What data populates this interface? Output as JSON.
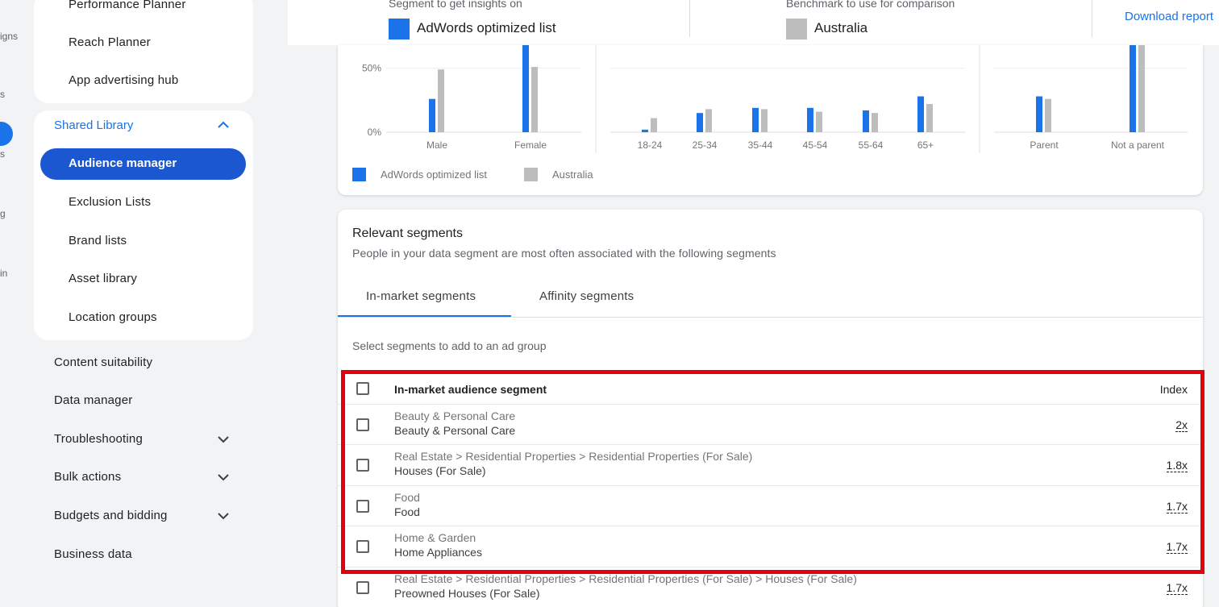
{
  "rail": {
    "labels": [
      "igns",
      "s",
      "s",
      "g",
      "in"
    ]
  },
  "sidebar": {
    "top_items": [
      "Performance Planner",
      "Reach Planner",
      "App advertising hub"
    ],
    "library_header": "Shared Library",
    "active_item": "Audience manager",
    "library_items": [
      "Exclusion Lists",
      "Brand lists",
      "Asset library",
      "Location groups"
    ],
    "section_items": [
      "Content suitability",
      "Data manager",
      "Troubleshooting",
      "Bulk actions",
      "Budgets and bidding",
      "Business data"
    ]
  },
  "topbar": {
    "segment_label": "Segment to get insights on",
    "segment_value": "AdWords optimized list",
    "benchmark_label": "Benchmark to use for comparison",
    "benchmark_value": "Australia",
    "download_label": "Download report",
    "colors": {
      "segment": "#1a73e8",
      "benchmark": "#bdbdbd"
    }
  },
  "chart_data": [
    {
      "type": "bar",
      "categories": [
        "Male",
        "Female"
      ],
      "series": [
        {
          "name": "AdWords optimized list",
          "values": [
            26,
            74
          ]
        },
        {
          "name": "Australia",
          "values": [
            49,
            51
          ]
        }
      ],
      "yticks": [
        "50%",
        "0%"
      ],
      "ylim": [
        0,
        68
      ]
    },
    {
      "type": "bar",
      "categories": [
        "18-24",
        "25-34",
        "35-44",
        "45-54",
        "55-64",
        "65+"
      ],
      "series": [
        {
          "name": "AdWords optimized list",
          "values": [
            2,
            15,
            19,
            19,
            17,
            28
          ]
        },
        {
          "name": "Australia",
          "values": [
            11,
            18,
            18,
            16,
            15,
            22
          ]
        }
      ],
      "ylim": [
        0,
        68
      ]
    },
    {
      "type": "bar",
      "categories": [
        "Parent",
        "Not a parent"
      ],
      "series": [
        {
          "name": "AdWords optimized list",
          "values": [
            28,
            72
          ]
        },
        {
          "name": "Australia",
          "values": [
            26,
            74
          ]
        }
      ],
      "ylim": [
        0,
        68
      ]
    }
  ],
  "legend": {
    "series_a": "AdWords optimized list",
    "series_b": "Australia"
  },
  "segments": {
    "title": "Relevant segments",
    "subtitle": "People in your data segment are most often associated with the following segments",
    "tabs": [
      "In-market segments",
      "Affinity segments"
    ],
    "hint": "Select segments to add to an ad group",
    "header": {
      "segment": "In-market audience segment",
      "index": "Index"
    },
    "rows": [
      {
        "path": "Beauty & Personal Care",
        "name": "Beauty & Personal Care",
        "index": "2x"
      },
      {
        "path": "Real Estate > Residential Properties > Residential Properties (For Sale)",
        "name": "Houses (For Sale)",
        "index": "1.8x"
      },
      {
        "path": "Food",
        "name": "Food",
        "index": "1.7x"
      },
      {
        "path": "Home & Garden",
        "name": "Home Appliances",
        "index": "1.7x"
      },
      {
        "path": "Real Estate > Residential Properties > Residential Properties (For Sale) > Houses (For Sale)",
        "name": "Preowned Houses (For Sale)",
        "index": "1.7x"
      }
    ]
  }
}
